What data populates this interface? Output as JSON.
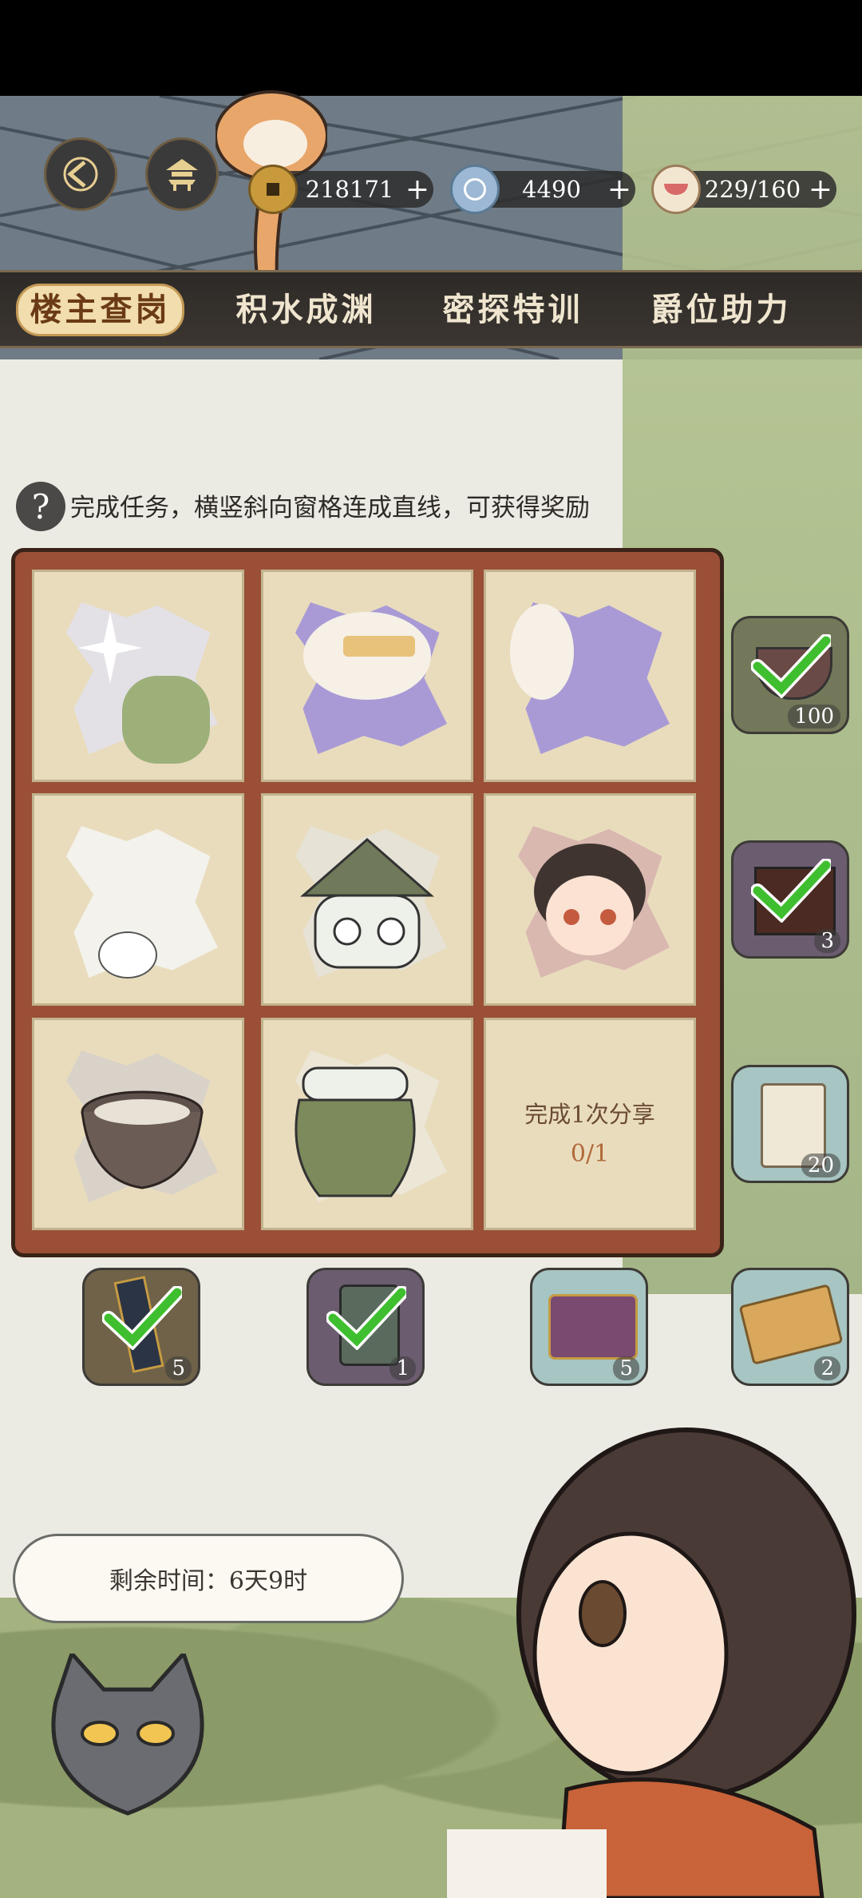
{
  "currencies": [
    {
      "icon": "copper-coin-icon",
      "value": "218171"
    },
    {
      "icon": "silver-orb-icon",
      "value": "4490"
    },
    {
      "icon": "food-bowl-icon",
      "value": "229/160"
    }
  ],
  "plus_glyph": "+",
  "tabs": [
    {
      "label": "楼主查岗",
      "active": true
    },
    {
      "label": "积水成渊",
      "active": false
    },
    {
      "label": "密探特训",
      "active": false
    },
    {
      "label": "爵位助力",
      "active": false
    }
  ],
  "help_glyph": "?",
  "instruction": "完成任务，横竖斜向窗格连成直线，可获得奖励",
  "board": {
    "cells": [
      {
        "type": "revealed",
        "art": "sparkle-character"
      },
      {
        "type": "revealed",
        "art": "dessert-plate"
      },
      {
        "type": "revealed",
        "art": "purple-window"
      },
      {
        "type": "revealed",
        "art": "white-cat-character"
      },
      {
        "type": "revealed",
        "art": "pagoda-lantern"
      },
      {
        "type": "revealed",
        "art": "chibi-character"
      },
      {
        "type": "revealed",
        "art": "mortar"
      },
      {
        "type": "revealed",
        "art": "jar"
      },
      {
        "type": "task",
        "task": "完成1次分享",
        "progress": "0/1"
      }
    ]
  },
  "row_rewards": [
    {
      "icon": "soup-bowl-icon",
      "count": "100",
      "claimed": true
    },
    {
      "icon": "cabinet-icon",
      "count": "3",
      "claimed": true
    },
    {
      "icon": "scroll-icon",
      "count": "20",
      "claimed": false
    }
  ],
  "column_rewards": [
    {
      "icon": "ink-stick-icon",
      "count": "5",
      "claimed": true
    },
    {
      "icon": "defense-token-icon",
      "count": "1",
      "claimed": true
    },
    {
      "icon": "treasure-box-icon",
      "count": "5",
      "claimed": false
    }
  ],
  "diagonal_reward": {
    "icon": "bamboo-scroll-icon",
    "count": "2",
    "claimed": false
  },
  "remaining_time": "剩余时间：6天9时",
  "colors": {
    "accent": "#9a4f36",
    "check": "#3fbf2f",
    "tab_active": "#f1ddae"
  }
}
